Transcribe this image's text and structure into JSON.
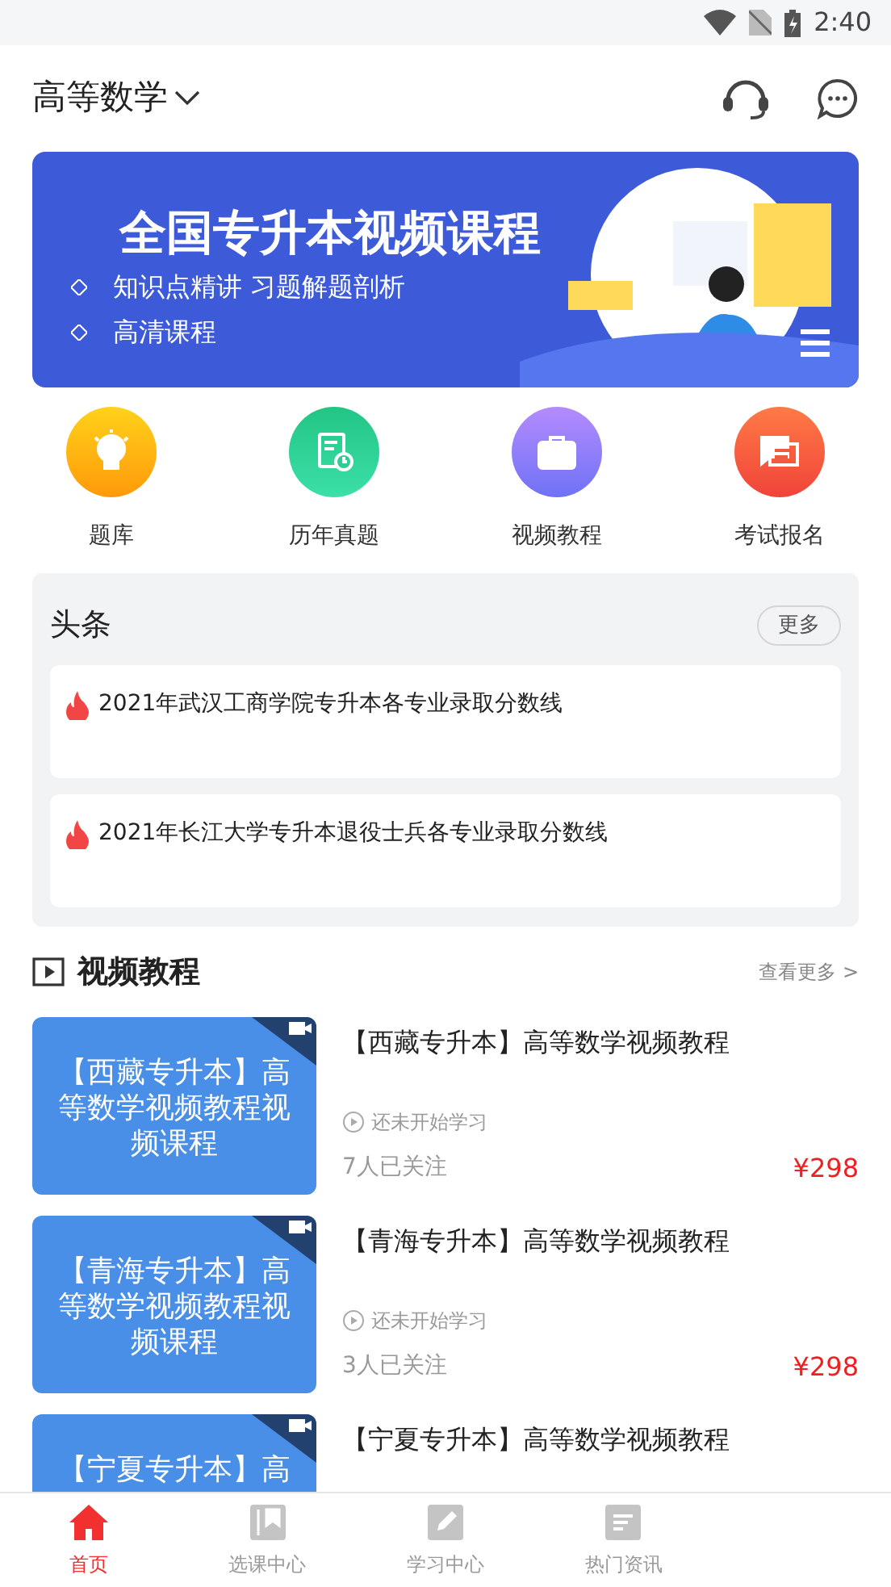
{
  "status_bar": {
    "time": "2:40"
  },
  "header": {
    "title": "高等数学"
  },
  "banner": {
    "title": "全国专升本视频课程",
    "bullets": [
      "知识点精讲 习题解题剖析",
      "高清课程"
    ]
  },
  "shortcuts": [
    {
      "label": "题库",
      "kind": "bulb"
    },
    {
      "label": "历年真题",
      "kind": "paper"
    },
    {
      "label": "视频教程",
      "kind": "bag"
    },
    {
      "label": "考试报名",
      "kind": "chat"
    }
  ],
  "headlines": {
    "title": "头条",
    "more": "更多",
    "items": [
      "2021年武汉工商学院专升本各专业录取分数线",
      "2021年长江大学专升本退役士兵各专业录取分数线"
    ]
  },
  "videos": {
    "title": "视频教程",
    "more": "查看更多 >",
    "items": [
      {
        "thumb_text": "【西藏专升本】高等数学视频教程视频课程",
        "title": "【西藏专升本】高等数学视频教程",
        "status": "还未开始学习",
        "followers": "7人已关注",
        "price": "¥298"
      },
      {
        "thumb_text": "【青海专升本】高等数学视频教程视频课程",
        "title": "【青海专升本】高等数学视频教程",
        "status": "还未开始学习",
        "followers": "3人已关注",
        "price": "¥298"
      },
      {
        "thumb_text": "【宁夏专升本】高",
        "title": "【宁夏专升本】高等数学视频教程"
      }
    ]
  },
  "tab_bar": [
    {
      "label": "首页",
      "selected": true,
      "kind": "home"
    },
    {
      "label": "选课中心",
      "selected": false,
      "kind": "book"
    },
    {
      "label": "学习中心",
      "selected": false,
      "kind": "pen"
    },
    {
      "label": "热门资讯",
      "selected": false,
      "kind": "news"
    }
  ]
}
